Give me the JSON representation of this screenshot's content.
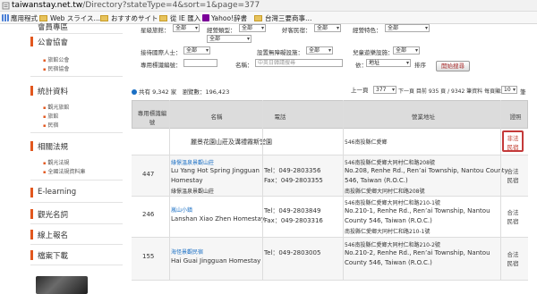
{
  "browser": {
    "url_host": "taiwanstay.net.tw",
    "url_path": "/Directory?stateType=4&sort=1&page=377",
    "bookmarks": [
      "應用程式",
      "Web スライス…",
      "おすすめサイト",
      "從 IE 匯入",
      "Yahoo!辞書",
      "台灣三要商事…"
    ]
  },
  "sidebar": {
    "sections": [
      {
        "title": "公會協會",
        "subs": [
          "旅館公會",
          "民宿協會"
        ]
      },
      {
        "title": "統計資料",
        "subs": [
          "觀光旅館",
          "旅館",
          "民宿"
        ]
      },
      {
        "title": "相關法規",
        "subs": [
          "觀光法規",
          "全國法規資料庫"
        ]
      },
      {
        "title": "E-learning",
        "subs": []
      },
      {
        "title": "觀光名詞",
        "subs": []
      },
      {
        "title": "線上報名",
        "subs": []
      },
      {
        "title": "檔案下載",
        "subs": []
      }
    ],
    "top_partial": "會員專區"
  },
  "filters": {
    "l1": "星級旅館：",
    "v1": "全部",
    "l2": "經營類型：",
    "v2": "全部",
    "l3": "好客民宿：",
    "v3": "全部",
    "l4": "經營特色：",
    "v4": "全部",
    "v5": "全部",
    "l6": "接待國際人士：",
    "v6": "全部",
    "l7": "設置無障礙設施：",
    "v7": "全部",
    "l8": "兒童遊樂設施：",
    "v8": "全部",
    "l9": "專用標識編號：",
    "l10": "名稱：",
    "p10": "中英日韓請搜尋",
    "l11": "依：",
    "v11": "地址",
    "l12": "排序",
    "btn": "開始搜尋"
  },
  "summary": {
    "count_text": "共有 9,342 家",
    "views_text": "瀏覽數：196,423",
    "pager_prefix": "上一頁",
    "page_value": "377",
    "pager_text": "下一頁  目前 935 頁 / 9342 筆資料 每頁顯示",
    "per_page": "10",
    "per_page_suffix": "筆"
  },
  "table": {
    "headers": {
      "id": "專用標識編號",
      "name": "名稱",
      "phone": "電話",
      "address": "營業地址",
      "status": "證照"
    },
    "rows": [
      {
        "id": "",
        "name": "麗景花園山莊及溝禮霧斯堂園",
        "name_en": "",
        "name_zh2": "",
        "tel": "",
        "fax": "",
        "addr1": "546南投縣仁愛鄉",
        "addr2": "",
        "addr3": "",
        "addr4": "",
        "status1": "非法",
        "status2": "民宿"
      },
      {
        "id": "447",
        "name": "綠憬溫泉景觀山莊",
        "name_en": "Lu Yang Hot Spring Jingguan",
        "name_zh2": "Homestay",
        "name_zh3": "綠憬溫泉景觀山莊",
        "tel": "Tel：049-2803356",
        "fax": "Fax：049-2803355",
        "addr1": "546南投縣仁愛鄉大同村仁和路208號",
        "addr2": "No.208, Renhe Rd., Ren’ai Township, Nantou County",
        "addr3": "546, Taiwan (R.O.C.)",
        "addr4": "南投縣仁愛鄉大同村仁和路208號",
        "status1": "合法",
        "status2": "民宿"
      },
      {
        "id": "246",
        "name": "嵐山小鎮",
        "name_en": "Lanshan Xiao Zhen Homestay",
        "name_zh2": "",
        "name_zh3": "",
        "tel": "Tel：049-2803849",
        "fax": "Fax：049-2803316",
        "addr1": "546南投縣仁愛鄉大同村仁和路210-1號",
        "addr2": "No.210-1, Renhe Rd., Ren’ai Township, Nantou",
        "addr3": "County 546, Taiwan (R.O.C.)",
        "addr4": "南投縣仁愛鄉大同村仁和路210-1號",
        "status1": "合法",
        "status2": "民宿"
      },
      {
        "id": "155",
        "name": "海怪景觀民宿",
        "name_en": "Hai Guai Jingguan Homestay",
        "name_zh2": "",
        "name_zh3": "",
        "tel": "Tel：049-2803005",
        "fax": "",
        "addr1": "546南投縣仁愛鄉大同村仁和路210-2號",
        "addr2": "No.210-2, Renhe Rd., Ren’ai Township, Nantou",
        "addr3": "County 546, Taiwan (R.O.C.)",
        "addr4": "",
        "status1": "合法",
        "status2": "民宿"
      }
    ]
  },
  "colors": {
    "accent": "#e2571e",
    "link": "#1a6fc4",
    "highlight": "#c43a3a"
  }
}
